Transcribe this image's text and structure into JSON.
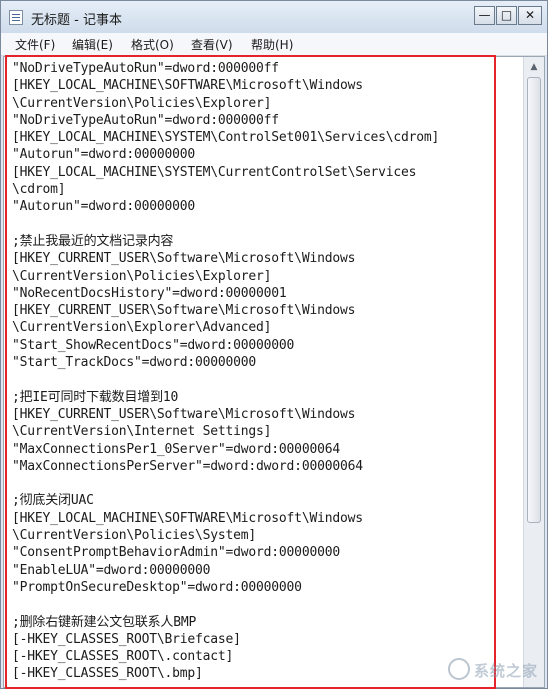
{
  "window": {
    "title": "无标题 - 记事本",
    "minimize_glyph": "—",
    "maximize_glyph": "□",
    "close_glyph": "✕"
  },
  "menu": {
    "items": [
      {
        "label": "文件(F)"
      },
      {
        "label": "编辑(E)"
      },
      {
        "label": "格式(O)"
      },
      {
        "label": "查看(V)"
      },
      {
        "label": "帮助(H)"
      }
    ]
  },
  "editor": {
    "lines": [
      "\"NoDriveTypeAutoRun\"=dword:000000ff",
      "[HKEY_LOCAL_MACHINE\\SOFTWARE\\Microsoft\\Windows",
      "\\CurrentVersion\\Policies\\Explorer]",
      "\"NoDriveTypeAutoRun\"=dword:000000ff",
      "[HKEY_LOCAL_MACHINE\\SYSTEM\\ControlSet001\\Services\\cdrom]",
      "\"Autorun\"=dword:00000000",
      "[HKEY_LOCAL_MACHINE\\SYSTEM\\CurrentControlSet\\Services",
      "\\cdrom]",
      "\"Autorun\"=dword:00000000",
      "",
      ";禁止我最近的文档记录内容",
      "[HKEY_CURRENT_USER\\Software\\Microsoft\\Windows",
      "\\CurrentVersion\\Policies\\Explorer]",
      "\"NoRecentDocsHistory\"=dword:00000001",
      "[HKEY_CURRENT_USER\\Software\\Microsoft\\Windows",
      "\\CurrentVersion\\Explorer\\Advanced]",
      "\"Start_ShowRecentDocs\"=dword:00000000",
      "\"Start_TrackDocs\"=dword:00000000",
      "",
      ";把IE可同时下载数目增到10",
      "[HKEY_CURRENT_USER\\Software\\Microsoft\\Windows",
      "\\CurrentVersion\\Internet Settings]",
      "\"MaxConnectionsPer1_0Server\"=dword:00000064",
      "\"MaxConnectionsPerServer\"=dword:dword:00000064",
      "",
      ";彻底关闭UAC",
      "[HKEY_LOCAL_MACHINE\\SOFTWARE\\Microsoft\\Windows",
      "\\CurrentVersion\\Policies\\System]",
      "\"ConsentPromptBehaviorAdmin\"=dword:00000000",
      "\"EnableLUA\"=dword:00000000",
      "\"PromptOnSecureDesktop\"=dword:00000000",
      "",
      ";删除右键新建公文包联系人BMP",
      "[-HKEY_CLASSES_ROOT\\Briefcase]",
      "[-HKEY_CLASSES_ROOT\\.contact]",
      "[-HKEY_CLASSES_ROOT\\.bmp]"
    ]
  },
  "scrollbar": {
    "up_glyph": "▲"
  },
  "watermark": {
    "text": "系统之家"
  },
  "colors": {
    "highlight_border": "#e5232b"
  }
}
